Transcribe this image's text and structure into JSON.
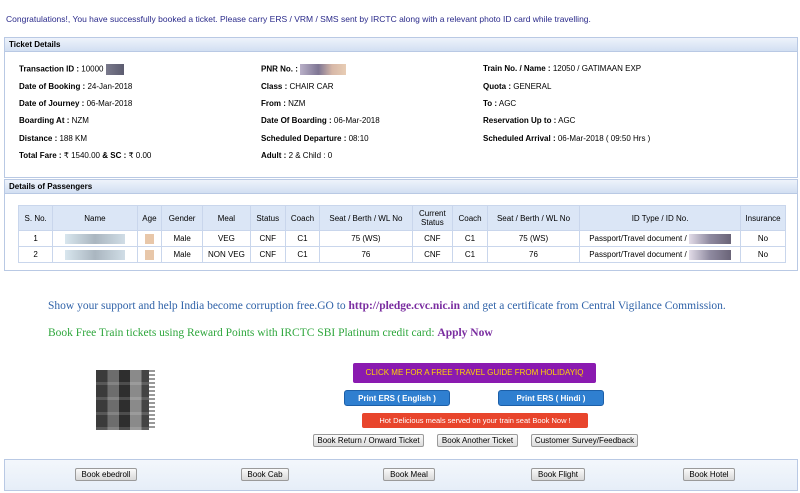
{
  "top_message": "Congratulations!, You have successfully booked a ticket. Please carry ERS / VRM / SMS sent by IRCTC along with a relevant photo ID card while travelling.",
  "ticket": {
    "heading": "Ticket Details",
    "transaction_label": "Transaction ID :",
    "transaction_value": "10000",
    "pnr_label": "PNR No. :",
    "train_label": "Train No. / Name :",
    "train_value": "12050 / GATIMAAN EXP",
    "booking_date_label": "Date of Booking :",
    "booking_date_value": "24-Jan-2018",
    "class_label": "Class :",
    "class_value": "CHAIR CAR",
    "quota_label": "Quota :",
    "quota_value": "GENERAL",
    "journey_label": "Date of Journey :",
    "journey_value": "06-Mar-2018",
    "from_label": "From :",
    "from_value": "NZM",
    "to_label": "To :",
    "to_value": "AGC",
    "boarding_at_label": "Boarding At :",
    "boarding_at_value": "NZM",
    "boarding_date_label": "Date Of Boarding :",
    "boarding_date_value": "06-Mar-2018",
    "reservation_label": "Reservation Up to :",
    "reservation_value": "AGC",
    "distance_label": "Distance :",
    "distance_value": "188 KM",
    "sched_dep_label": "Scheduled Departure :",
    "sched_dep_value": "08:10",
    "sched_arr_label": "Scheduled Arrival :",
    "sched_arr_value": "06-Mar-2018 ( 09:50 Hrs )",
    "fare_label": "Total Fare :",
    "fare_value": "₹ 1540.00",
    "sc_label": "& SC :",
    "sc_value": "₹ 0.00",
    "adult_label": "Adult :",
    "adult_value": "2 & Child : 0"
  },
  "passengers": {
    "heading": "Details of Passengers",
    "columns": [
      "S. No.",
      "Name",
      "Age",
      "Gender",
      "Meal",
      "Status",
      "Coach",
      "Seat / Berth / WL No",
      "Current Status",
      "Coach",
      "Seat / Berth / WL No",
      "ID Type / ID No.",
      "Insurance"
    ],
    "rows": [
      {
        "sno": "1",
        "gender": "Male",
        "meal": "VEG",
        "status": "CNF",
        "coach": "C1",
        "seat": "75 (WS)",
        "current_status": "CNF",
        "current_coach": "C1",
        "current_seat": "75 (WS)",
        "id_type": "Passport/Travel document /",
        "insurance": "No"
      },
      {
        "sno": "2",
        "gender": "Male",
        "meal": "NON VEG",
        "status": "CNF",
        "coach": "C1",
        "seat": "76",
        "current_status": "CNF",
        "current_coach": "C1",
        "current_seat": "76",
        "id_type": "Passport/Travel document /",
        "insurance": "No"
      }
    ]
  },
  "promo": {
    "support_prefix": "Show your support and help India become corruption free.GO to",
    "support_link": "http://pledge.cvc.nic.in",
    "support_suffix": "and get a certificate from Central Vigilance Commission.",
    "reward_text": "Book Free Train tickets using Reward Points with IRCTC SBI Platinum credit card:",
    "reward_link": "Apply Now"
  },
  "actions": {
    "holiday": "CLICK ME FOR A FREE TRAVEL GUIDE FROM HOLIDAYIQ",
    "ers_english": "Print ERS ( English )",
    "ers_hindi": "Print ERS ( Hindi )",
    "meal": "Hot Delicious meals served on your train seat Book Now !",
    "book_return": "Book Return / Onward Ticket",
    "book_another": "Book Another Ticket",
    "survey": "Customer Survey/Feedback"
  },
  "footer": {
    "ebedroll": "Book ebedroll",
    "cab": "Book Cab",
    "meal": "Book Meal",
    "flight": "Book Flight",
    "hotel": "Book Hotel"
  }
}
